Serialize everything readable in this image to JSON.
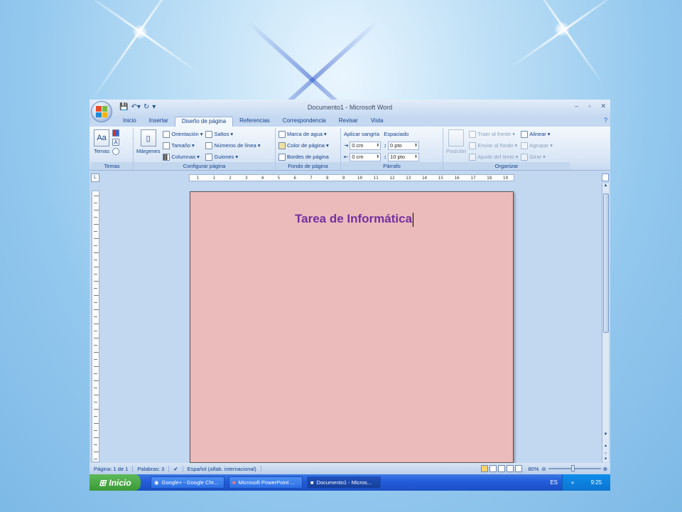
{
  "window": {
    "title": "Documento1 - Microsoft Word",
    "controls": [
      "–",
      "▫",
      "✕"
    ]
  },
  "tabs": [
    "Inicio",
    "Insertar",
    "Diseño de página",
    "Referencias",
    "Correspondencia",
    "Revisar",
    "Vista"
  ],
  "ribbon": {
    "temas": {
      "label": "Temas",
      "btn": "Temas"
    },
    "configurar": {
      "label": "Configurar página",
      "margenes": "Márgenes",
      "orientacion": "Orientación",
      "tamano": "Tamaño",
      "columnas": "Columnas",
      "saltos": "Saltos",
      "numeros": "Números de línea",
      "guiones": "Guiones"
    },
    "fondo": {
      "label": "Fondo de página",
      "marca": "Marca de agua",
      "color": "Color de página",
      "bordes": "Bordes de página"
    },
    "parrafo": {
      "label": "Párrafo",
      "sangria": "Aplicar sangría",
      "espaciado": "Espaciado",
      "izq": "0 cm",
      "der": "0 cm",
      "antes": "0 pto",
      "despues": "10 pto"
    },
    "organizar": {
      "label": "Organizar",
      "posicion": "Posición",
      "traer": "Traer al frente",
      "enviar": "Enviar al fondo",
      "ajuste": "Ajuste del texto",
      "alinear": "Alinear",
      "agrupar": "Agrupar",
      "girar": "Girar"
    }
  },
  "ruler": [
    "1",
    "1",
    "2",
    "3",
    "4",
    "5",
    "6",
    "7",
    "8",
    "9",
    "10",
    "11",
    "12",
    "13",
    "14",
    "15",
    "16",
    "17",
    "18",
    "19"
  ],
  "document": {
    "title": "Tarea de Informática"
  },
  "status": {
    "pagina": "Página: 1 de 1",
    "palabras": "Palabras: 3",
    "idioma": "Español (alfab. internacional)",
    "zoom": "80%"
  },
  "taskbar": {
    "start": "Inicio",
    "tasks": [
      "Google+ - Google Chr...",
      "Microsoft PowerPoint ...",
      "Documento1 - Micros..."
    ],
    "lang": "ES",
    "clock": "9:25"
  },
  "colors": {
    "page": "#ebbabb",
    "title": "#7330a0",
    "ribbon": "#dbe7f6"
  }
}
